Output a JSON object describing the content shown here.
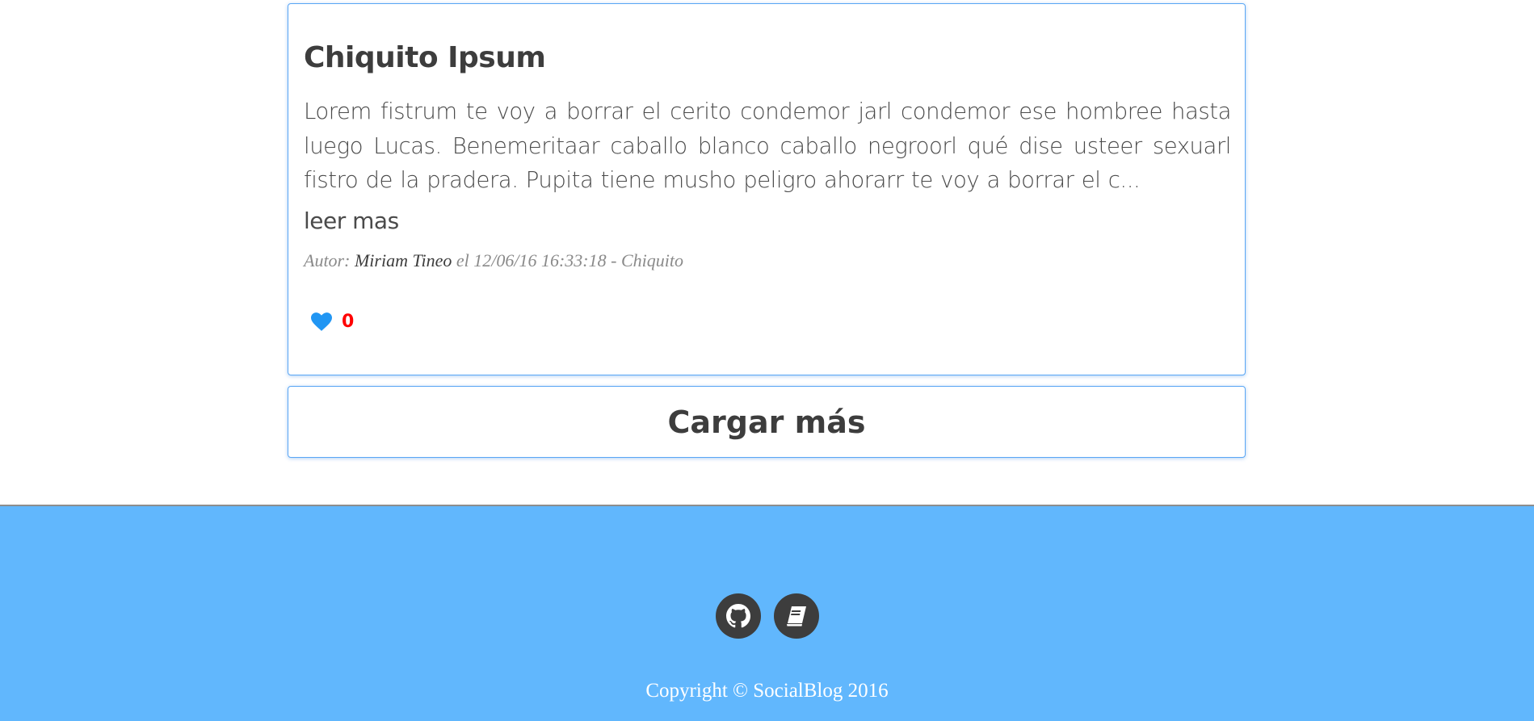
{
  "post": {
    "title": "Chiquito Ipsum",
    "excerpt": "Lorem fistrum te voy a borrar el cerito condemor jarl condemor ese hombree hasta luego Lucas. Benemeritaar caballo blanco caballo negroorl qué dise usteer sexuarl fistro de la pradera. Pupita tiene musho peligro ahorarr te voy a borrar el c...",
    "read_more_label": "leer mas",
    "meta": {
      "author_prefix": "Autor: ",
      "author_name": "Miriam Tineo",
      "date_text": " el 12/06/16 16:33:18",
      "category_text": " - Chiquito"
    },
    "like": {
      "icon": "heart-icon",
      "count": "0"
    }
  },
  "load_more_label": "Cargar más",
  "footer": {
    "icons": [
      "github-icon",
      "book-icon"
    ],
    "copyright": "Copyright © SocialBlog 2016"
  },
  "colors": {
    "accent_border": "#5aa6f5",
    "footer_background": "#61b7fd",
    "heart": "#2196f3",
    "like_count": "#ff0000",
    "text_dark": "#3d3d3d"
  }
}
